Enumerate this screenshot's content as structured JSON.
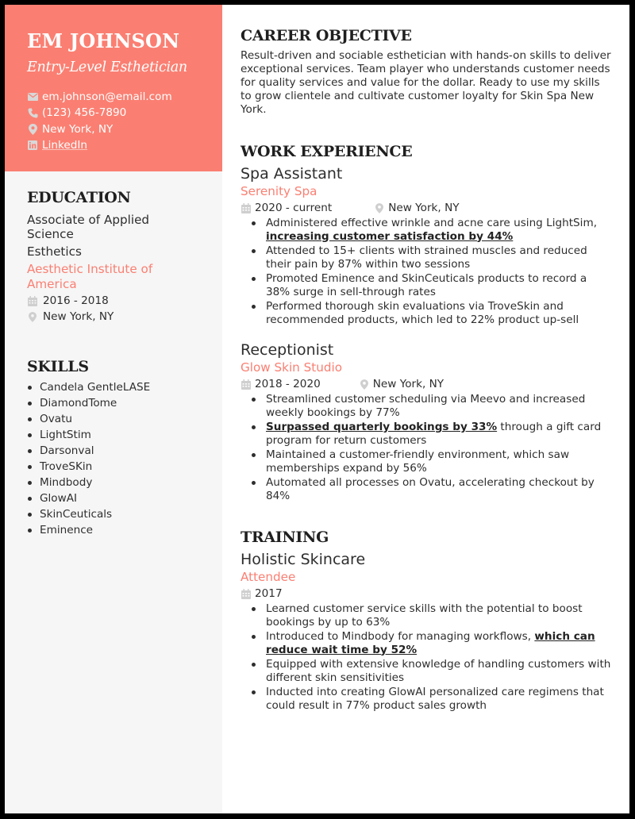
{
  "header": {
    "name": "EM JOHNSON",
    "title": "Entry-Level Esthetician",
    "contacts": [
      {
        "icon": "envelope-icon",
        "text": "em.johnson@email.com",
        "link": false
      },
      {
        "icon": "phone-icon",
        "text": "(123) 456-7890",
        "link": false
      },
      {
        "icon": "location-pin-icon",
        "text": "New York, NY",
        "link": false
      },
      {
        "icon": "linkedin-icon",
        "text": "LinkedIn",
        "link": true
      }
    ]
  },
  "colors": {
    "accent": "#fa7f72",
    "sidebar_bg": "#f6f6f6",
    "frame": "#000000",
    "text": "#2e2e2e",
    "icon_gray": "#c8c8c8"
  },
  "education": {
    "heading": "EDUCATION",
    "degree": "Associate of Applied Science",
    "field": "Esthetics",
    "school": "Aesthetic Institute of America",
    "dates": "2016 - 2018",
    "location": "New York, NY"
  },
  "skills": {
    "heading": "SKILLS",
    "items": [
      "Candela GentleLASE",
      "DiamondTome",
      "Ovatu",
      "LightStim",
      "Darsonval",
      "TroveSKin",
      "Mindbody",
      "GlowAI",
      "SkinCeuticals",
      "Eminence"
    ]
  },
  "objective": {
    "heading": "CAREER OBJECTIVE",
    "text": "Result-driven and sociable esthetician with hands-on skills to deliver exceptional services. Team player who understands customer needs for quality services and value for the dollar. Ready to use my skills to grow clientele and cultivate customer loyalty for Skin Spa New York."
  },
  "work": {
    "heading": "WORK EXPERIENCE",
    "jobs": [
      {
        "title": "Spa Assistant",
        "company": "Serenity Spa",
        "dates": "2020 - current",
        "location": "New York, NY",
        "bullets": [
          {
            "pre": "Administered effective wrinkle and acne care using LightSim, ",
            "bold": "increasing customer satisfaction by 44%",
            "post": ""
          },
          {
            "pre": "Attended to 15+ clients with strained muscles and reduced their pain by 87% within two sessions",
            "bold": "",
            "post": ""
          },
          {
            "pre": "Promoted Eminence and SkinCeuticals products to record a 38% surge in sell-through rates",
            "bold": "",
            "post": ""
          },
          {
            "pre": "Performed thorough skin evaluations via TroveSkin and recommended products, which led to 22% product up-sell",
            "bold": "",
            "post": ""
          }
        ]
      },
      {
        "title": "Receptionist",
        "company": "Glow Skin Studio",
        "dates": "2018 - 2020",
        "location": "New York, NY",
        "bullets": [
          {
            "pre": "Streamlined customer scheduling via Meevo and increased weekly bookings by 77%",
            "bold": "",
            "post": ""
          },
          {
            "pre": "",
            "bold": "Surpassed quarterly bookings by 33%",
            "post": " through a gift card program for return customers"
          },
          {
            "pre": "Maintained a customer-friendly environment, which saw memberships expand by 56%",
            "bold": "",
            "post": ""
          },
          {
            "pre": "Automated all processes on Ovatu, accelerating checkout by 84%",
            "bold": "",
            "post": ""
          }
        ]
      }
    ]
  },
  "training": {
    "heading": "TRAINING",
    "title": "Holistic Skincare",
    "role": "Attendee",
    "dates": "2017",
    "bullets": [
      {
        "pre": "Learned customer service skills with the potential to boost bookings by up to 63%",
        "bold": "",
        "post": ""
      },
      {
        "pre": "Introduced to Mindbody for managing workflows, ",
        "bold": "which can reduce wait time by 52%",
        "post": ""
      },
      {
        "pre": "Equipped with extensive knowledge of handling customers with different skin sensitivities",
        "bold": "",
        "post": ""
      },
      {
        "pre": "Inducted into creating GlowAI personalized care regimens that could result in 77% product sales growth",
        "bold": "",
        "post": ""
      }
    ]
  }
}
